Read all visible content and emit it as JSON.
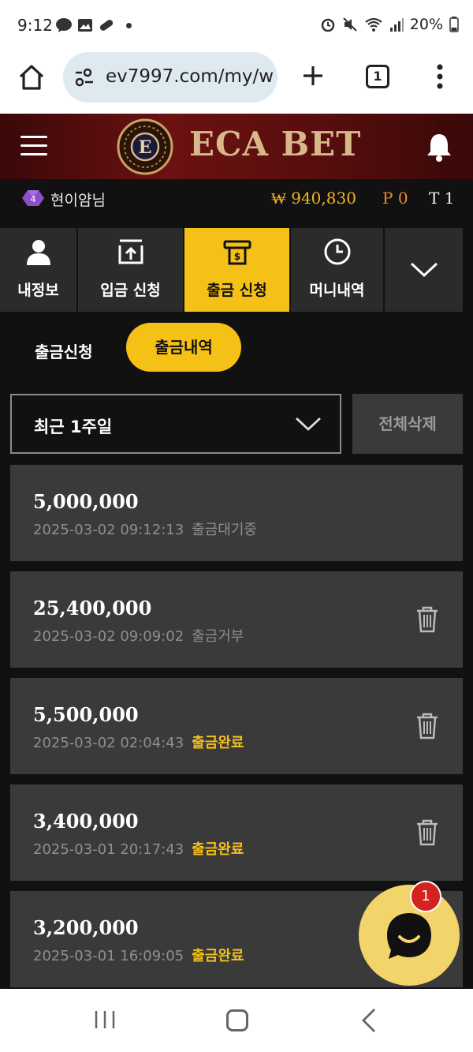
{
  "status_bar": {
    "time": "9:12",
    "battery": "20%"
  },
  "browser": {
    "url": "ev7997.com/my/w",
    "tab_count": "1"
  },
  "header": {
    "logo_text": "ECA BET",
    "emblem_letter": "E"
  },
  "user": {
    "level": "4",
    "name": "현이얌님",
    "balance": "₩ 940,830",
    "points": "P 0",
    "tier": "T 1"
  },
  "menu_tabs": [
    {
      "label": "내정보",
      "icon": "person-icon"
    },
    {
      "label": "입금 신청",
      "icon": "deposit-icon"
    },
    {
      "label": "출금 신청",
      "icon": "withdraw-icon",
      "active": true
    },
    {
      "label": "머니내역",
      "icon": "clock-icon"
    }
  ],
  "sub_tabs": {
    "request": "출금신청",
    "history": "출금내역"
  },
  "filter": {
    "period": "최근 1주일",
    "delete_all": "전체삭제"
  },
  "history": [
    {
      "amount": "5,000,000",
      "datetime": "2025-03-02 09:12:13",
      "status": "출금대기중",
      "status_type": "other"
    },
    {
      "amount": "25,400,000",
      "datetime": "2025-03-02 09:09:02",
      "status": "출금거부",
      "status_type": "other"
    },
    {
      "amount": "5,500,000",
      "datetime": "2025-03-02 02:04:43",
      "status": "출금완료",
      "status_type": "done"
    },
    {
      "amount": "3,400,000",
      "datetime": "2025-03-01 20:17:43",
      "status": "출금완료",
      "status_type": "done"
    },
    {
      "amount": "3,200,000",
      "datetime": "2025-03-01 16:09:05",
      "status": "출금완료",
      "status_type": "done"
    }
  ],
  "chat": {
    "badge": "1"
  },
  "colors": {
    "accent": "#f6c116",
    "panel": "#3a3a3b",
    "header": "#5a0e0e",
    "balance": "#f2b621",
    "points": "#f08a2a"
  }
}
